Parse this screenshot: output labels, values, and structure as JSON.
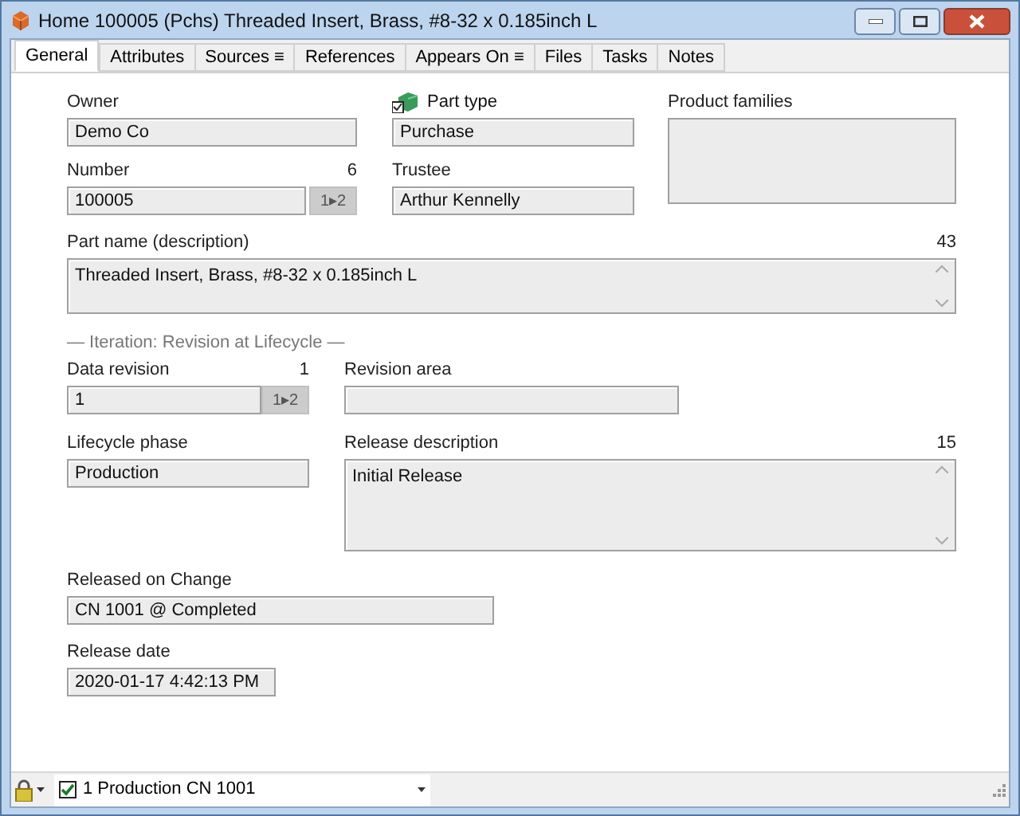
{
  "window": {
    "title": "Home 100005 (Pchs) Threaded Insert, Brass, #8-32 x 0.185inch L"
  },
  "tabs": [
    {
      "label": "General",
      "selected": true
    },
    {
      "label": "Attributes",
      "selected": false
    },
    {
      "label": "Sources ≡",
      "selected": false
    },
    {
      "label": "References",
      "selected": false
    },
    {
      "label": "Appears On ≡",
      "selected": false
    },
    {
      "label": "Files",
      "selected": false
    },
    {
      "label": "Tasks",
      "selected": false
    },
    {
      "label": "Notes",
      "selected": false
    }
  ],
  "general": {
    "owner": {
      "label": "Owner",
      "value": "Demo Co"
    },
    "part_type": {
      "label": "Part type",
      "value": "Purchase"
    },
    "product_families": {
      "label": "Product families"
    },
    "number": {
      "label": "Number",
      "count": "6",
      "value": "100005",
      "button": "1▸2"
    },
    "trustee": {
      "label": "Trustee",
      "value": "Arthur Kennelly"
    },
    "part_name": {
      "label": "Part name (description)",
      "count": "43",
      "value": "Threaded Insert, Brass, #8-32 x 0.185inch L"
    },
    "iteration_heading": "— Iteration: Revision at Lifecycle —",
    "data_revision": {
      "label": "Data revision",
      "count": "1",
      "value": "1",
      "button": "1▸2"
    },
    "revision_area": {
      "label": "Revision area"
    },
    "lifecycle_phase": {
      "label": "Lifecycle phase",
      "value": "Production"
    },
    "release_description": {
      "label": "Release description",
      "count": "15",
      "value": "Initial Release"
    },
    "released_on_change": {
      "label": "Released on Change",
      "value": "CN 1001 @ Completed"
    },
    "release_date": {
      "label": "Release date",
      "value": "2020-01-17 4:42:13 PM"
    }
  },
  "status_bar": {
    "checked": true,
    "text": "1 Production CN 1001"
  }
}
